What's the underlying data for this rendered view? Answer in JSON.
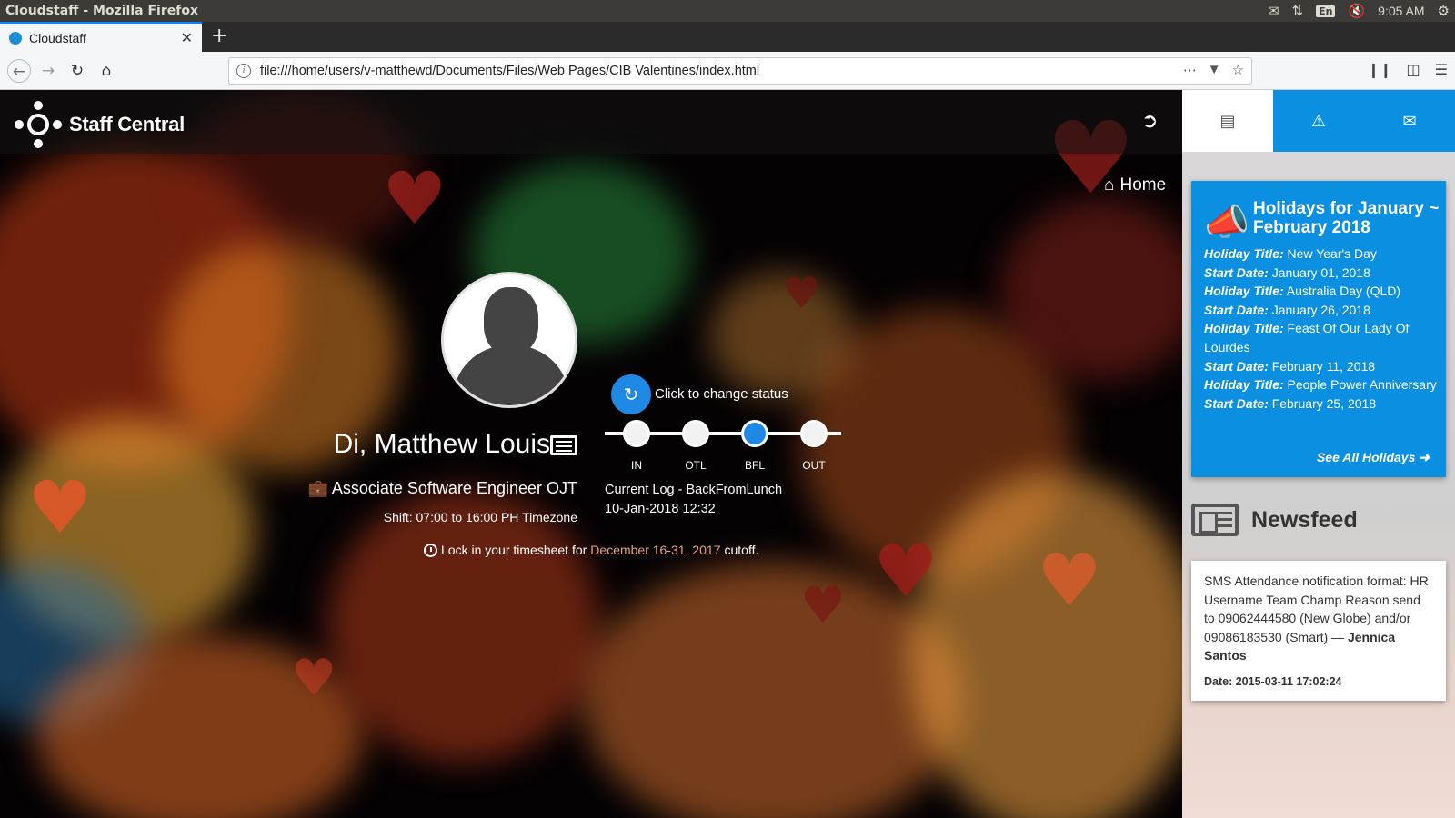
{
  "os": {
    "window_title": "Cloudstaff - Mozilla Firefox",
    "lang": "En",
    "time": "9:05 AM"
  },
  "browser": {
    "tab_title": "Cloudstaff",
    "url": "file:///home/users/v-matthewd/Documents/Files/Web Pages/CIB Valentines/index.html"
  },
  "app": {
    "logo_text": "Staff Central",
    "breadcrumb": "Home",
    "accent_color": "#1e88e5"
  },
  "profile": {
    "name": "Di, Matthew Louis",
    "title": "Associate Software Engineer OJT",
    "shift": "Shift: 07:00 to 16:00 PH Timezone"
  },
  "status": {
    "change_label": "Click to change status",
    "steps": [
      {
        "label": "IN",
        "active": false
      },
      {
        "label": "OTL",
        "active": false
      },
      {
        "label": "BFL",
        "active": true
      },
      {
        "label": "OUT",
        "active": false
      }
    ],
    "current_log_label": "Current Log - BackFromLunch",
    "current_log_time": "10-Jan-2018 12:32"
  },
  "timesheet": {
    "prefix": "Lock in your timesheet for",
    "period": "December 16-31, 2017",
    "suffix": "cutoff."
  },
  "sidebar": {
    "tabs": [
      {
        "icon": "newspaper-icon"
      },
      {
        "icon": "warning-icon"
      },
      {
        "icon": "envelope-open-icon"
      }
    ],
    "holidays": {
      "title": "Holidays for January ~ February 2018",
      "title_key": "Holiday Title:",
      "date_key": "Start Date:",
      "items": [
        {
          "title": "New Year's Day",
          "date": "January 01, 2018"
        },
        {
          "title": "Australia Day (QLD)",
          "date": "January 26, 2018"
        },
        {
          "title": "Feast Of Our Lady Of Lourdes",
          "date": "February 11, 2018"
        },
        {
          "title": "People Power Anniversary",
          "date": "February 25, 2018"
        }
      ],
      "see_all": "See All Holidays"
    },
    "newsfeed": {
      "heading": "Newsfeed",
      "message": "SMS Attendance notification format: HR Username Team Champ Reason send to 09062444580 (New Globe) and/or 09086183530 (Smart) —",
      "author": "Jennica Santos",
      "date": "Date: 2015-03-11 17:02:24"
    }
  }
}
